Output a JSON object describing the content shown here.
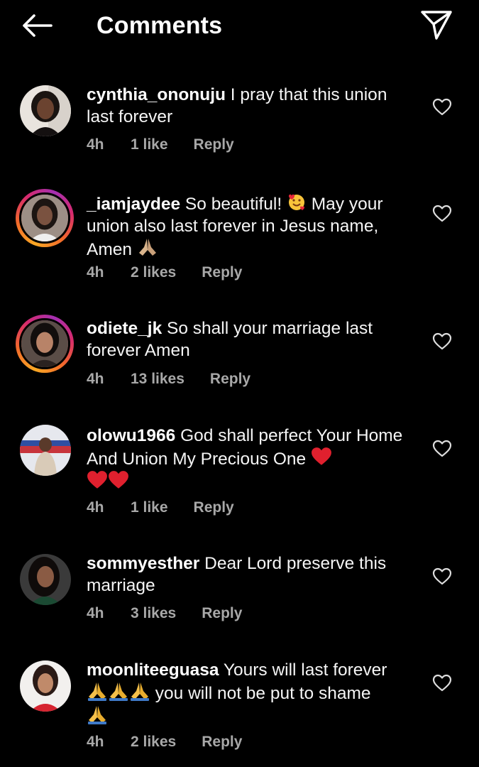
{
  "header": {
    "title": "Comments",
    "back_icon": "arrow-left-icon",
    "share_icon": "paper-plane-icon"
  },
  "colors": {
    "background": "#000000",
    "meta_text": "#a8a8a8",
    "story_ring_start": "#f9a824",
    "story_ring_end": "#a42fb1",
    "heart_emoji": "#e0202e",
    "pray_emoji": "#f5c04a"
  },
  "comments": [
    {
      "username": "cynthia_ononuju",
      "text": " I pray that this union last forever",
      "time": "4h",
      "likes": "1 like",
      "reply": "Reply",
      "story_ring": false
    },
    {
      "username": "_iamjaydee",
      "text_a": " So beautiful! ",
      "text_b": " May your union also last forever in Jesus name, Amen ",
      "time": "4h",
      "likes": "2 likes",
      "reply": "Reply",
      "story_ring": true
    },
    {
      "username": "odiete_jk",
      "text": " So shall your marriage last forever Amen",
      "time": "4h",
      "likes": "13 likes",
      "reply": "Reply",
      "story_ring": true
    },
    {
      "username": "olowu1966",
      "text": " God shall perfect Your Home And Union My Precious One ",
      "time": "4h",
      "likes": "1 like",
      "reply": "Reply",
      "story_ring": false
    },
    {
      "username": "sommyesther",
      "text": " Dear Lord preserve this marriage",
      "time": "4h",
      "likes": "3 likes",
      "reply": "Reply",
      "story_ring": false
    },
    {
      "username": "moonliteeguasa",
      "text_a": " Yours will last forever ",
      "text_b": " you will not be put to shame ",
      "time": "4h",
      "likes": "2 likes",
      "reply": "Reply",
      "story_ring": false
    }
  ]
}
